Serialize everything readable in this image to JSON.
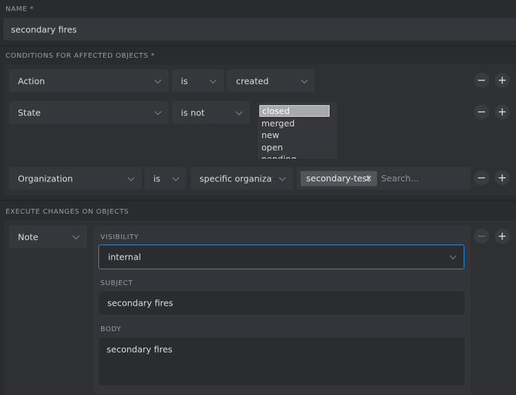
{
  "name_field": {
    "label": "NAME *",
    "value": "secondary fires"
  },
  "conditions": {
    "label": "CONDITIONS FOR AFFECTED OBJECTS *",
    "rows": [
      {
        "attribute": "Action",
        "operator": "is",
        "value": "created"
      },
      {
        "attribute": "State",
        "operator": "is not",
        "options": [
          "closed",
          "merged",
          "new",
          "open",
          "pending"
        ],
        "selected": "closed"
      },
      {
        "attribute": "Organization",
        "operator": "is",
        "value": "specific organization",
        "token": "secondary-test",
        "search_placeholder": "Search..."
      }
    ]
  },
  "execute": {
    "label": "EXECUTE CHANGES ON OBJECTS",
    "object": "Note",
    "visibility_label": "VISIBILITY",
    "visibility_value": "internal",
    "subject_label": "SUBJECT",
    "subject_value": "secondary fires",
    "body_label": "BODY",
    "body_value": "secondary fires"
  },
  "buttons": {
    "remove": "−",
    "add": "+"
  },
  "icons": [
    "chevron-down-icon",
    "close-icon",
    "minus-icon",
    "plus-icon"
  ],
  "colors": {
    "background": "#2a2b2f",
    "field": "#36373c",
    "focus": "#2f8ad8",
    "selected_option": "#a9a9ad"
  }
}
